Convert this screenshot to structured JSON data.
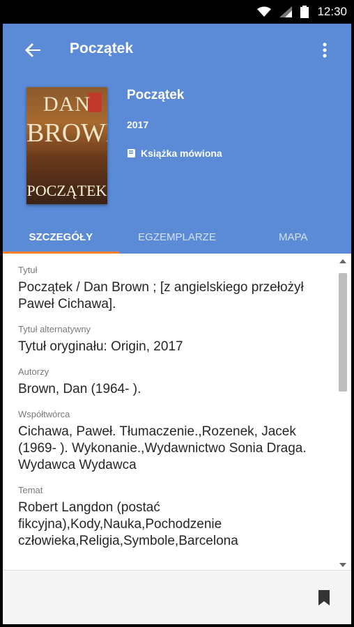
{
  "status_bar": {
    "time": "12:30",
    "icons": [
      "wifi-icon",
      "signal-icon",
      "battery-icon"
    ]
  },
  "app_bar": {
    "title": "Początek"
  },
  "book": {
    "cover_author_first": "DAN",
    "cover_author_last": "BROWN",
    "cover_title": "POCZĄTEK",
    "title": "Początek",
    "year": "2017",
    "type": "Książka mówiona"
  },
  "tabs": [
    {
      "label": "SZCZEGÓŁY",
      "active": true
    },
    {
      "label": "EGZEMPLARZE",
      "active": false
    },
    {
      "label": "MAPA",
      "active": false
    }
  ],
  "details": [
    {
      "label": "Tytuł",
      "value": "Początek / Dan Brown ; [z angielskiego przełożył Paweł Cichawa]."
    },
    {
      "label": "Tytuł alternatywny",
      "value": "Tytuł oryginału: Origin, 2017"
    },
    {
      "label": "Autorzy",
      "value": "Brown, Dan (1964- )."
    },
    {
      "label": "Współtwórca",
      "value": "Cichawa, Paweł. Tłumaczenie.,Rozenek, Jacek (1969- ). Wykonanie.,Wydawnictwo Sonia Draga. Wydawca Wydawca"
    },
    {
      "label": "Temat",
      "value": "Robert Langdon (postać fikcyjna),Kody,Nauka,Pochodzenie człowieka,Religia,Symbole,Barcelona"
    }
  ],
  "colors": {
    "primary": "#5b8ad6",
    "accent": "#ff7f2a"
  }
}
